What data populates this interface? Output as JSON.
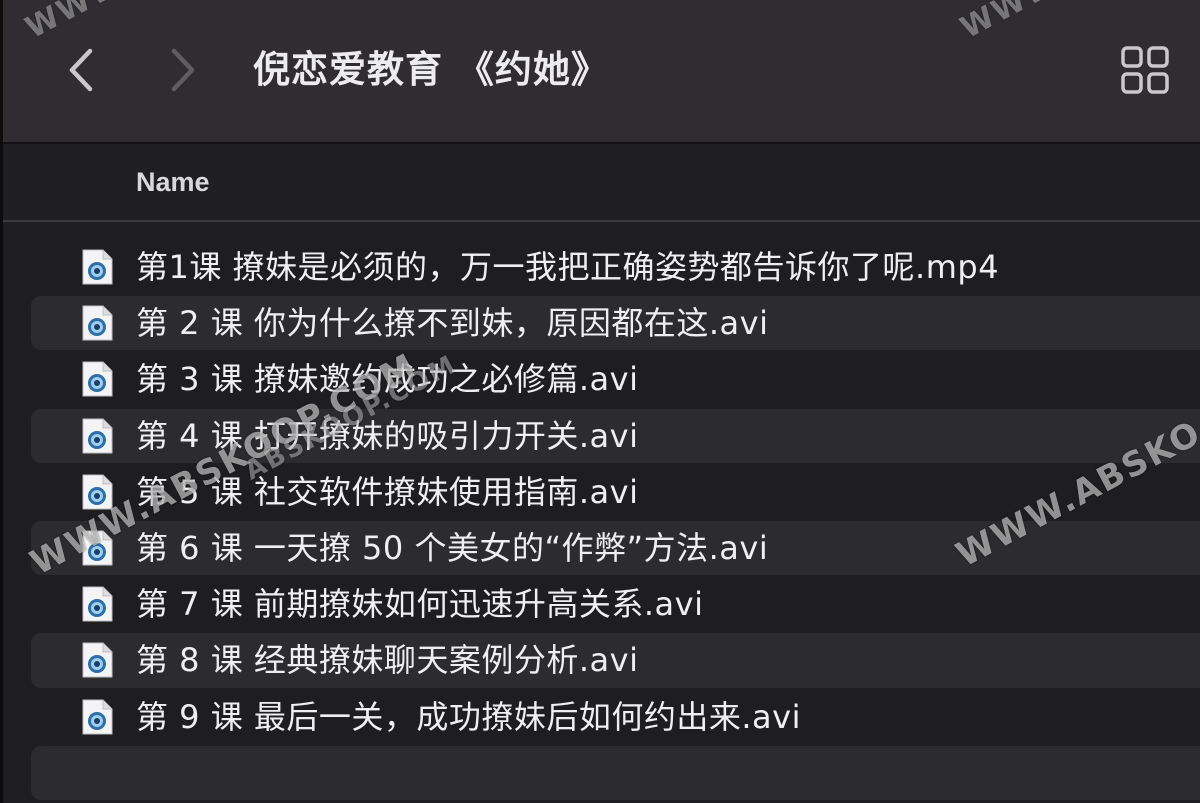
{
  "toolbar": {
    "title": "倪恋爱教育 《约她》",
    "back_icon": "chevron-left-icon",
    "forward_icon": "chevron-right-icon",
    "view_icon": "grid-view-icon"
  },
  "columns": {
    "name": "Name"
  },
  "files": [
    {
      "name": "第1课 撩妹是必须的，万一我把正确姿势都告诉你了呢.mp4",
      "icon": "video-file-icon"
    },
    {
      "name": "第 2 课 你为什么撩不到妹，原因都在这.avi",
      "icon": "video-file-icon"
    },
    {
      "name": "第 3 课 撩妹邀约成功之必修篇.avi",
      "icon": "video-file-icon"
    },
    {
      "name": "第 4 课 打开撩妹的吸引力开关.avi",
      "icon": "video-file-icon"
    },
    {
      "name": "第 5 课 社交软件撩妹使用指南.avi",
      "icon": "video-file-icon"
    },
    {
      "name": "第 6 课 一天撩 50 个美女的“作弊”方法.avi",
      "icon": "video-file-icon"
    },
    {
      "name": "第 7 课 前期撩妹如何迅速升高关系.avi",
      "icon": "video-file-icon"
    },
    {
      "name": "第 8 课 经典撩妹聊天案例分析.avi",
      "icon": "video-file-icon"
    },
    {
      "name": "第 9 课 最后一关，成功撩妹后如何约出来.avi",
      "icon": "video-file-icon"
    }
  ],
  "watermarks": {
    "wm1": "WWW.ABSKOOP.COM",
    "wm2": "WWW.ABSKO",
    "wm3": "ABSKOOP.COM",
    "wm4": "WWW.",
    "wm5": "WWW."
  },
  "colors": {
    "toolbar_bg": "#2f2d31",
    "list_bg": "#1e1d20",
    "alt_row_bg": "#2c2b2e",
    "text": "#efeff1"
  }
}
